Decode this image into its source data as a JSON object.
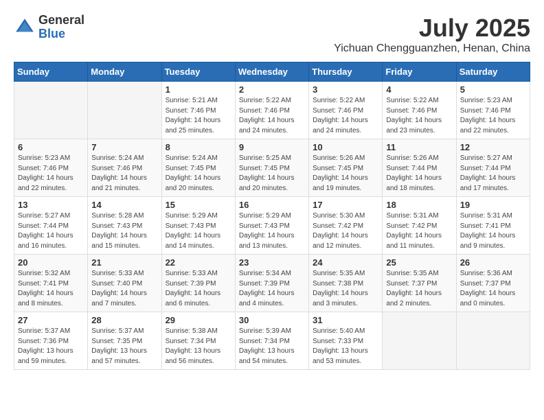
{
  "logo": {
    "general": "General",
    "blue": "Blue"
  },
  "title": "July 2025",
  "subtitle": "Yichuan Chengguanzhen, Henan, China",
  "header_days": [
    "Sunday",
    "Monday",
    "Tuesday",
    "Wednesday",
    "Thursday",
    "Friday",
    "Saturday"
  ],
  "weeks": [
    [
      {
        "day": "",
        "info": ""
      },
      {
        "day": "",
        "info": ""
      },
      {
        "day": "1",
        "info": "Sunrise: 5:21 AM\nSunset: 7:46 PM\nDaylight: 14 hours and 25 minutes."
      },
      {
        "day": "2",
        "info": "Sunrise: 5:22 AM\nSunset: 7:46 PM\nDaylight: 14 hours and 24 minutes."
      },
      {
        "day": "3",
        "info": "Sunrise: 5:22 AM\nSunset: 7:46 PM\nDaylight: 14 hours and 24 minutes."
      },
      {
        "day": "4",
        "info": "Sunrise: 5:22 AM\nSunset: 7:46 PM\nDaylight: 14 hours and 23 minutes."
      },
      {
        "day": "5",
        "info": "Sunrise: 5:23 AM\nSunset: 7:46 PM\nDaylight: 14 hours and 22 minutes."
      }
    ],
    [
      {
        "day": "6",
        "info": "Sunrise: 5:23 AM\nSunset: 7:46 PM\nDaylight: 14 hours and 22 minutes."
      },
      {
        "day": "7",
        "info": "Sunrise: 5:24 AM\nSunset: 7:46 PM\nDaylight: 14 hours and 21 minutes."
      },
      {
        "day": "8",
        "info": "Sunrise: 5:24 AM\nSunset: 7:45 PM\nDaylight: 14 hours and 20 minutes."
      },
      {
        "day": "9",
        "info": "Sunrise: 5:25 AM\nSunset: 7:45 PM\nDaylight: 14 hours and 20 minutes."
      },
      {
        "day": "10",
        "info": "Sunrise: 5:26 AM\nSunset: 7:45 PM\nDaylight: 14 hours and 19 minutes."
      },
      {
        "day": "11",
        "info": "Sunrise: 5:26 AM\nSunset: 7:44 PM\nDaylight: 14 hours and 18 minutes."
      },
      {
        "day": "12",
        "info": "Sunrise: 5:27 AM\nSunset: 7:44 PM\nDaylight: 14 hours and 17 minutes."
      }
    ],
    [
      {
        "day": "13",
        "info": "Sunrise: 5:27 AM\nSunset: 7:44 PM\nDaylight: 14 hours and 16 minutes."
      },
      {
        "day": "14",
        "info": "Sunrise: 5:28 AM\nSunset: 7:43 PM\nDaylight: 14 hours and 15 minutes."
      },
      {
        "day": "15",
        "info": "Sunrise: 5:29 AM\nSunset: 7:43 PM\nDaylight: 14 hours and 14 minutes."
      },
      {
        "day": "16",
        "info": "Sunrise: 5:29 AM\nSunset: 7:43 PM\nDaylight: 14 hours and 13 minutes."
      },
      {
        "day": "17",
        "info": "Sunrise: 5:30 AM\nSunset: 7:42 PM\nDaylight: 14 hours and 12 minutes."
      },
      {
        "day": "18",
        "info": "Sunrise: 5:31 AM\nSunset: 7:42 PM\nDaylight: 14 hours and 11 minutes."
      },
      {
        "day": "19",
        "info": "Sunrise: 5:31 AM\nSunset: 7:41 PM\nDaylight: 14 hours and 9 minutes."
      }
    ],
    [
      {
        "day": "20",
        "info": "Sunrise: 5:32 AM\nSunset: 7:41 PM\nDaylight: 14 hours and 8 minutes."
      },
      {
        "day": "21",
        "info": "Sunrise: 5:33 AM\nSunset: 7:40 PM\nDaylight: 14 hours and 7 minutes."
      },
      {
        "day": "22",
        "info": "Sunrise: 5:33 AM\nSunset: 7:39 PM\nDaylight: 14 hours and 6 minutes."
      },
      {
        "day": "23",
        "info": "Sunrise: 5:34 AM\nSunset: 7:39 PM\nDaylight: 14 hours and 4 minutes."
      },
      {
        "day": "24",
        "info": "Sunrise: 5:35 AM\nSunset: 7:38 PM\nDaylight: 14 hours and 3 minutes."
      },
      {
        "day": "25",
        "info": "Sunrise: 5:35 AM\nSunset: 7:37 PM\nDaylight: 14 hours and 2 minutes."
      },
      {
        "day": "26",
        "info": "Sunrise: 5:36 AM\nSunset: 7:37 PM\nDaylight: 14 hours and 0 minutes."
      }
    ],
    [
      {
        "day": "27",
        "info": "Sunrise: 5:37 AM\nSunset: 7:36 PM\nDaylight: 13 hours and 59 minutes."
      },
      {
        "day": "28",
        "info": "Sunrise: 5:37 AM\nSunset: 7:35 PM\nDaylight: 13 hours and 57 minutes."
      },
      {
        "day": "29",
        "info": "Sunrise: 5:38 AM\nSunset: 7:34 PM\nDaylight: 13 hours and 56 minutes."
      },
      {
        "day": "30",
        "info": "Sunrise: 5:39 AM\nSunset: 7:34 PM\nDaylight: 13 hours and 54 minutes."
      },
      {
        "day": "31",
        "info": "Sunrise: 5:40 AM\nSunset: 7:33 PM\nDaylight: 13 hours and 53 minutes."
      },
      {
        "day": "",
        "info": ""
      },
      {
        "day": "",
        "info": ""
      }
    ]
  ]
}
